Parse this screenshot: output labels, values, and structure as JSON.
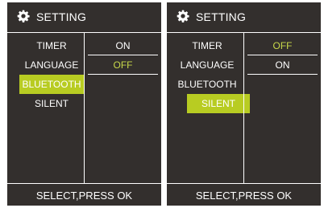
{
  "screens": [
    {
      "header": {
        "title": "SETTING",
        "icon": "gear-icon"
      },
      "menu": [
        "TIMER",
        "LANGUAGE",
        "BLUETOOTH",
        "SILENT"
      ],
      "selected_menu": "BLUETOOTH",
      "options": [
        "ON",
        "OFF"
      ],
      "active_option": "OFF",
      "footer": "SELECT,PRESS OK"
    },
    {
      "header": {
        "title": "SETTING",
        "icon": "gear-icon"
      },
      "menu": [
        "TIMER",
        "LANGUAGE",
        "BLUETOOTH",
        "SILENT"
      ],
      "selected_menu": "SILENT",
      "options": [
        "OFF",
        "ON"
      ],
      "active_option": "OFF",
      "footer": "SELECT,PRESS OK"
    }
  ],
  "colors": {
    "screen_bg": "#332f2d",
    "highlight": "#b8cc22",
    "active_text": "#c8d84a",
    "text": "#ffffff"
  }
}
